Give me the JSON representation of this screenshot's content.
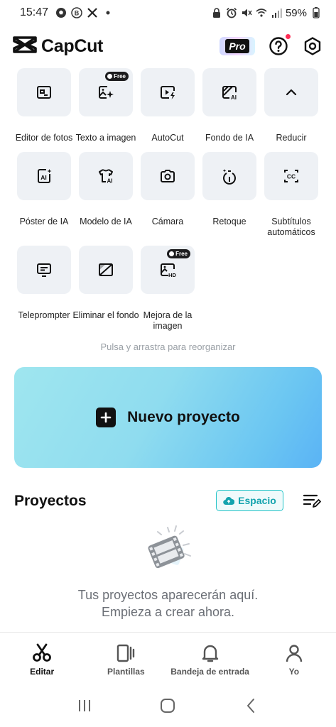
{
  "status_bar": {
    "time": "15:47",
    "battery": "59%",
    "left_icons": [
      "soccer-ball-icon",
      "b-icon",
      "x-logo-icon",
      "dot-icon"
    ],
    "right_icons": [
      "lock-icon",
      "alarm-icon",
      "mute-icon",
      "wifi-icon",
      "signal-icon",
      "battery-icon"
    ]
  },
  "header": {
    "app_name": "CapCut",
    "pro_label": "Pro"
  },
  "tools": [
    {
      "label": "Editor de fotos",
      "icon": "photo-editor-icon",
      "free": false
    },
    {
      "label": "Texto a imagen",
      "icon": "text-to-image-icon",
      "free": true
    },
    {
      "label": "AutoCut",
      "icon": "autocut-icon",
      "free": false
    },
    {
      "label": "Fondo de IA",
      "icon": "ai-background-icon",
      "free": false
    },
    {
      "label": "Reducir",
      "icon": "chevron-up-icon",
      "free": false
    },
    {
      "label": "Póster de IA",
      "icon": "ai-poster-icon",
      "free": false
    },
    {
      "label": "Modelo de IA",
      "icon": "ai-model-icon",
      "free": false
    },
    {
      "label": "Cámara",
      "icon": "camera-icon",
      "free": false
    },
    {
      "label": "Retoque",
      "icon": "retouch-icon",
      "free": false
    },
    {
      "label": "Subtítulos automáticos",
      "icon": "captions-icon",
      "free": false
    },
    {
      "label": "Teleprompter",
      "icon": "teleprompter-icon",
      "free": false
    },
    {
      "label": "Eliminar el fondo",
      "icon": "remove-background-icon",
      "free": false
    },
    {
      "label": "Mejora de la imagen",
      "icon": "image-upscale-icon",
      "free": true
    }
  ],
  "free_label": "Free",
  "hint": "Pulsa y arrastra para reorganizar",
  "new_project": {
    "label": "Nuevo proyecto"
  },
  "projects": {
    "title": "Proyectos",
    "space_button": "Espacio",
    "empty_line1": "Tus proyectos aparecerán aquí.",
    "empty_line2": "Empieza a crear ahora."
  },
  "bottom_nav": [
    {
      "label": "Editar",
      "icon": "scissors-icon",
      "active": true
    },
    {
      "label": "Plantillas",
      "icon": "templates-icon",
      "active": false
    },
    {
      "label": "Bandeja de entrada",
      "icon": "bell-icon",
      "active": false
    },
    {
      "label": "Yo",
      "icon": "profile-icon",
      "active": false
    }
  ],
  "colors": {
    "accent": "#20c3c7",
    "tile_bg": "#eef1f5",
    "card_gradient_start": "#9fe6ef",
    "card_gradient_end": "#5ab3f5"
  }
}
